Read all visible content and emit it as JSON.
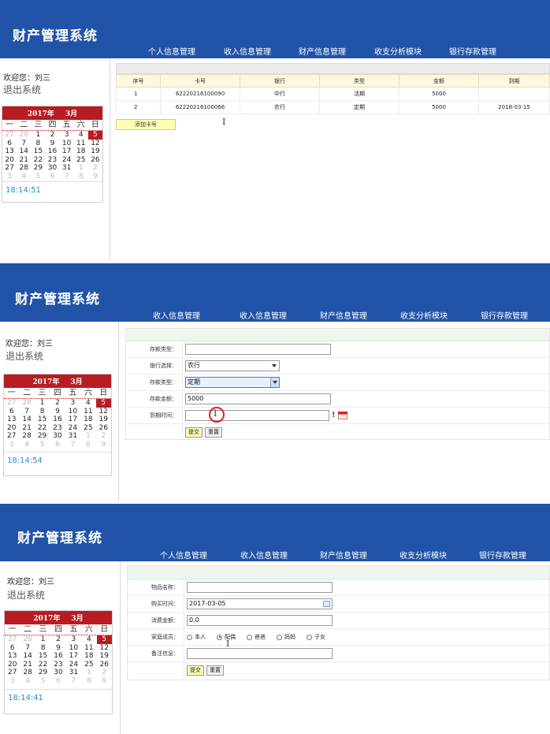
{
  "app_title": "财产管理系统",
  "nav_panels": [
    [
      "个人信息管理",
      "收入信息管理",
      "财产信息管理",
      "收支分析模块",
      "银行存款管理"
    ],
    [
      "收入信息管理",
      "收入信息管理",
      "财产信息管理",
      "收支分析模块",
      "银行存款管理"
    ],
    [
      "个人信息管理",
      "收入信息管理",
      "财产信息管理",
      "收支分析模块",
      "银行存款管理"
    ]
  ],
  "sidebar": {
    "welcome": "欢迎您：刘三",
    "logout": "退出系统"
  },
  "calendar": {
    "year_label": "2017年",
    "month_label": "3月",
    "weekdays": [
      "一",
      "二",
      "三",
      "四",
      "五",
      "六",
      "日"
    ],
    "weeks": [
      [
        "27",
        "28",
        "1",
        "2",
        "3",
        "4",
        "5"
      ],
      [
        "6",
        "7",
        "8",
        "9",
        "10",
        "11",
        "12"
      ],
      [
        "13",
        "14",
        "15",
        "16",
        "17",
        "18",
        "19"
      ],
      [
        "20",
        "21",
        "22",
        "23",
        "24",
        "25",
        "26"
      ],
      [
        "27",
        "28",
        "29",
        "30",
        "31",
        "1",
        "2"
      ],
      [
        "3",
        "4",
        "5",
        "6",
        "7",
        "8",
        "9"
      ]
    ],
    "times": [
      "18:14:51",
      "18:14:54",
      "18:14:41"
    ]
  },
  "cards_table": {
    "headers": [
      "序号",
      "卡号",
      "银行",
      "类型",
      "金额",
      "到期"
    ],
    "rows": [
      [
        "1",
        "62220216100090",
        "中行",
        "活期",
        "5000",
        ""
      ],
      [
        "2",
        "62220216100066",
        "农行",
        "定期",
        "5000",
        "2018-03-15"
      ]
    ],
    "add_button": "添加卡号"
  },
  "deposit_form": {
    "labels": [
      "存款类型：",
      "银行选择：",
      "存款类型：",
      "存款金额：",
      "到期时间："
    ],
    "bank_value": "农行",
    "type_value": "定期",
    "amount_value": "5000",
    "required_mark": "!",
    "submit": "提交",
    "reset": "重置"
  },
  "asset_form": {
    "labels": [
      "物品名称：",
      "购买时间：",
      "消费金额：",
      "家庭成员：",
      "备注信息："
    ],
    "purchase_date": "2017-03-05",
    "amount": "0.0",
    "members": [
      "本人",
      "配偶",
      "爸爸",
      "妈妈",
      "子女"
    ],
    "selected_member": "配偶",
    "submit": "提交",
    "reset": "重置"
  },
  "colors": {
    "header_blue": "#2153a8",
    "calendar_red": "#b81c22",
    "time_blue": "#2a8ccf",
    "add_button_yellow": "#ffffb3"
  }
}
